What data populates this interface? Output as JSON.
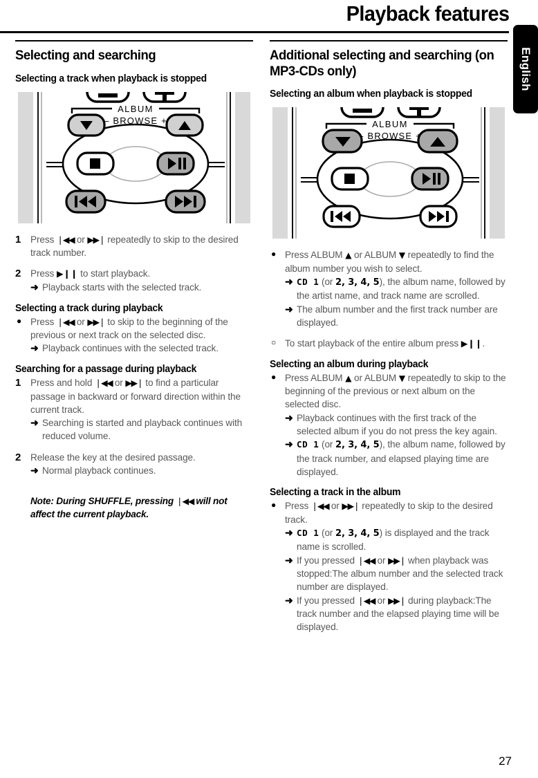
{
  "header": {
    "title": "Playback features",
    "language_tab": "English"
  },
  "page_number": "27",
  "left_column": {
    "section_title": "Selecting and searching",
    "sub1_title": "Selecting a track when playback is stopped",
    "illustration": {
      "name": "remote-control-transport-keys",
      "label_album": "ALBUM",
      "label_browse_minus": "– BROWSE +",
      "highlighted_keys": [
        "play-pause",
        "previous-track",
        "next-track"
      ]
    },
    "step1_num": "1",
    "step1_text_a": "Press ",
    "step1_glyph1": "❘◀◀",
    "step1_text_b": " or ",
    "step1_glyph2": "▶▶❘",
    "step1_text_c": " repeatedly to skip to the desired track number.",
    "step2_num": "2",
    "step2_text_a": "Press ",
    "step2_glyph1": "▶❙❙",
    "step2_text_b": " to start playback.",
    "step2_arrow": "Playback starts with the selected track.",
    "sub2_title": "Selecting a track during playback",
    "sub2_bullet_a": "Press ",
    "sub2_glyph1": "❘◀◀",
    "sub2_bullet_b": " or ",
    "sub2_glyph2": "▶▶❘",
    "sub2_bullet_c": " to skip to the beginning of the previous or next track on the selected disc.",
    "sub2_arrow": "Playback continues with the selected track.",
    "sub3_title": "Searching for a passage during playback",
    "sub3_num": "1",
    "sub3_text_a": "Press and hold ",
    "sub3_glyph1": "❘◀◀",
    "sub3_text_b": " or ",
    "sub3_glyph2": "▶▶❘",
    "sub3_text_c": " to find a particular passage in backward or forward direction within the current track.",
    "sub3_arrow": "Searching is started and playback continues with reduced volume.",
    "step4_num": "2",
    "step4_text": "Release the key at the desired passage.",
    "step4_arrow": "Normal playback continues.",
    "note_a": "Note: During SHUFFLE, pressing ",
    "note_glyph": "❘◀◀",
    "note_b": " will not affect the current playback."
  },
  "right_column": {
    "section_title": "Additional selecting and searching (on MP3-CDs only)",
    "sub1_title": "Selecting an album when playback is stopped",
    "illustration": {
      "name": "remote-control-album-keys",
      "label_album": "ALBUM",
      "label_browse_minus": "– BROWSE +",
      "highlighted_keys": [
        "album-down",
        "album-up",
        "play-pause"
      ]
    },
    "b1_a": "Press ALBUM ",
    "b1_up": "▲",
    "b1_b": " or ALBUM ",
    "b1_dn": "▼",
    "b1_c": " repeatedly to find the album number you wish to select.",
    "b1_arrow1_lcd": "CD 1",
    "b1_arrow1_a": " (or ",
    "b1_arrow1_nums": "2, 3, 4, 5",
    "b1_arrow1_b": "), the album name, followed by the artist name, and track name are scrolled.",
    "b1_arrow2": "The album number and the first track number are displayed.",
    "circle_a": "To start playback of the entire album press ",
    "circle_glyph": "▶❙❙",
    "circle_b": ".",
    "sub2_title": "Selecting an album during playback",
    "b2_a": "Press ALBUM ",
    "b2_up": "▲",
    "b2_b": " or ALBUM ",
    "b2_dn": "▼",
    "b2_c": " repeatedly to skip to the beginning of the previous or next album on the selected disc.",
    "b2_arrow1": "Playback continues with the first track of the selected album if you do not press the key again.",
    "b2_arrow2_lcd": "CD 1",
    "b2_arrow2_a": " (or ",
    "b2_arrow2_nums": "2, 3, 4, 5",
    "b2_arrow2_b": "), the album name, followed by the track number, and elapsed playing time are displayed.",
    "sub3_title": "Selecting a track in the album",
    "b3_a": "Press ",
    "b3_glyph1": "❘◀◀",
    "b3_b": " or ",
    "b3_glyph2": "▶▶❘",
    "b3_c": " repeatedly to skip to the desired track.",
    "b3_arrow1_lcd": "CD 1",
    "b3_arrow1_a": " (or ",
    "b3_arrow1_nums": "2, 3, 4, 5",
    "b3_arrow1_b": ") is displayed and the track name is scrolled.",
    "b3_arrow2_a": "If you pressed ",
    "b3_arrow2_g1": "❘◀◀",
    "b3_arrow2_b": " or ",
    "b3_arrow2_g2": "▶▶❘",
    "b3_arrow2_c": " when playback was stopped:The album number and the selected track number are displayed.",
    "b3_arrow3_a": "If you pressed ",
    "b3_arrow3_g1": "❘◀◀",
    "b3_arrow3_b": " or ",
    "b3_arrow3_g2": "▶▶❘",
    "b3_arrow3_c": " during playback:The track number and the elapsed playing time will be displayed."
  },
  "markers": {
    "bullet": "●",
    "circle": "○",
    "arrow": "➜"
  },
  "colors": {
    "ink": "#000000",
    "body_text": "#585858",
    "key_highlight": "#a8a8a8",
    "illustration_side": "#d9d9d9"
  }
}
